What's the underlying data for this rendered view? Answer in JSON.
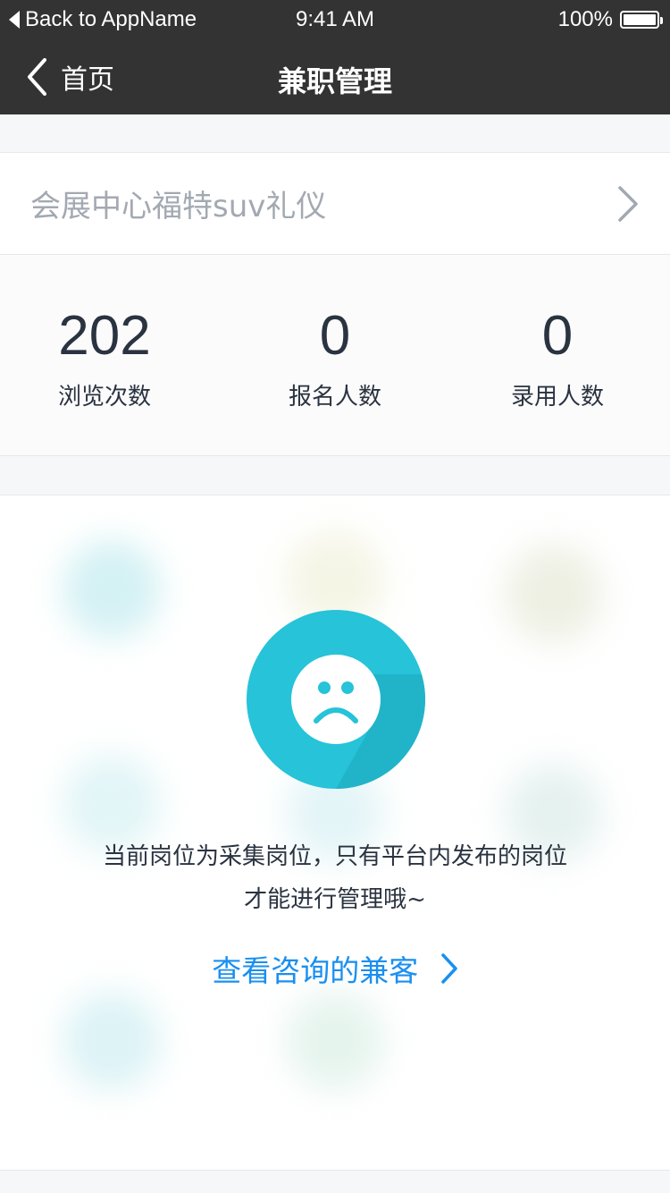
{
  "status_bar": {
    "back_label": "Back to AppName",
    "time": "9:41 AM",
    "battery": "100%"
  },
  "nav": {
    "back_label": "首页",
    "title": "兼职管理"
  },
  "job": {
    "title": "会展中心福特suv礼仪"
  },
  "stats": [
    {
      "value": "202",
      "label": "浏览次数"
    },
    {
      "value": "0",
      "label": "报名人数"
    },
    {
      "value": "0",
      "label": "录用人数"
    }
  ],
  "empty_state": {
    "message_line1": "当前岗位为采集岗位，只有平台内发布的岗位",
    "message_line2": "才能进行管理哦~",
    "link_label": "查看咨询的兼客"
  },
  "colors": {
    "nav_background": "#333333",
    "accent_teal": "#26c3d9",
    "link_blue": "#1a8ff0"
  }
}
